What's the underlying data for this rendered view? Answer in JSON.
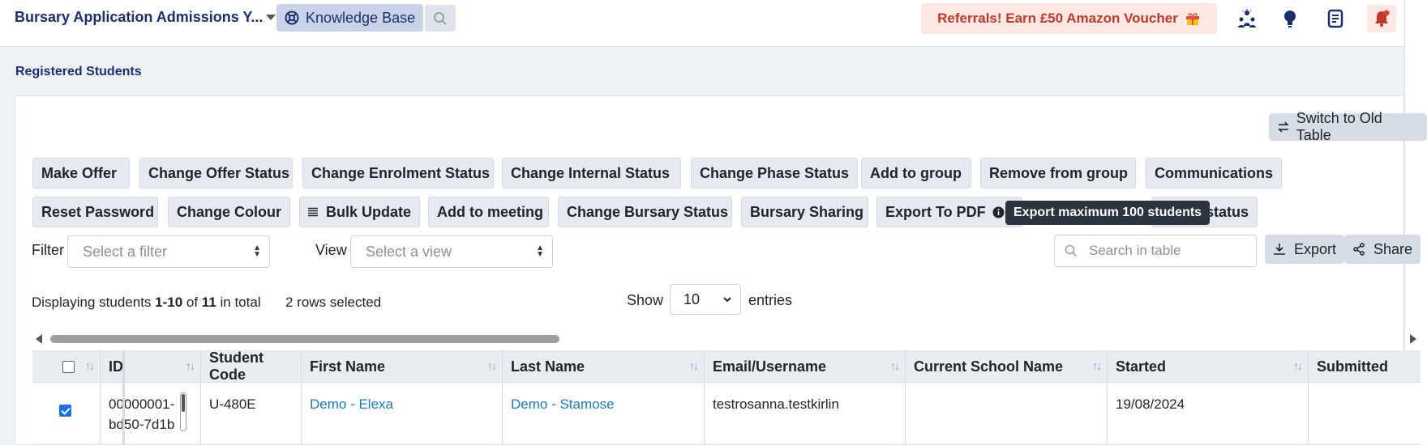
{
  "header": {
    "app_title": "Bursary Application Admissions Y...",
    "knowledge_base": "Knowledge Base",
    "referral": "Referrals! Earn £50 Amazon Voucher"
  },
  "page": {
    "section_title": "Registered Students",
    "switch_table": "Switch to Old Table"
  },
  "actions": {
    "row1": [
      "Make Offer",
      "Change Offer Status",
      "Change Enrolment Status",
      "Change Internal Status",
      "Change Phase Status",
      "Add to group",
      "Remove from group",
      "Communications"
    ],
    "row2": [
      "Reset Password",
      "Change Colour",
      "Bulk Update",
      "Add to meeting",
      "Change Bursary Status",
      "Bursary Sharing",
      "Export To PDF",
      "s status"
    ]
  },
  "tooltip": "Export maximum 100 students",
  "filters": {
    "filter_label": "Filter",
    "filter_placeholder": "Select a filter",
    "view_label": "View",
    "view_placeholder": "Select a view",
    "search_placeholder": "Search in table",
    "export": "Export",
    "share": "Share"
  },
  "info": {
    "prefix": "Displaying students ",
    "range": "1-10",
    "of": " of ",
    "total": "11",
    "suffix": " in total",
    "rows_selected": "2 rows selected",
    "show": "Show",
    "entries_value": "10",
    "entries": "entries"
  },
  "table": {
    "columns": [
      "ID",
      "Student Code",
      "First Name",
      "Last Name",
      "Email/Username",
      "Current School Name",
      "Started",
      "Submitted"
    ],
    "rows": [
      {
        "id_line1": "00000001-",
        "id_line2": "bd50-7d1b",
        "student_code": "U-480E",
        "first_name": "Demo - Elexa",
        "last_name": "Demo - Stamose",
        "email": "testrosanna.testkirlin",
        "school": "",
        "started": "19/08/2024",
        "submitted": "",
        "selected": true
      }
    ]
  }
}
